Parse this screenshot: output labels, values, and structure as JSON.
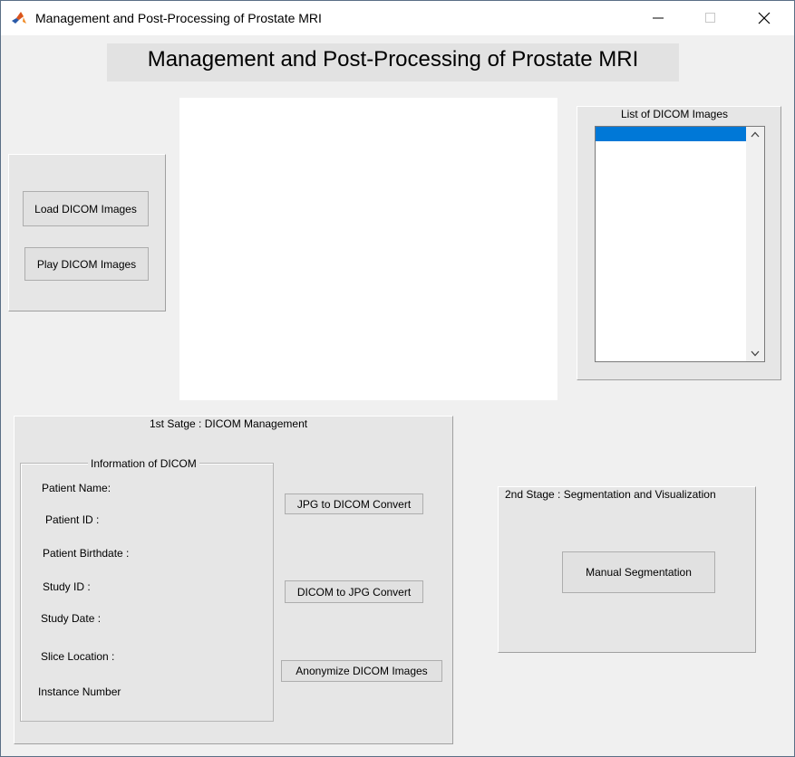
{
  "window": {
    "title": "Management and Post-Processing  of Prostate MRI",
    "icon": "matlab-icon"
  },
  "header": {
    "title": "Management and Post-Processing  of Prostate MRI"
  },
  "load_panel": {
    "load_button": "Load DICOM Images",
    "play_button": "Play DICOM Images"
  },
  "dicom_list": {
    "title": "List of DICOM Images",
    "items": [
      ""
    ]
  },
  "stage1": {
    "title": "1st Satge : DICOM Management",
    "info": {
      "title": "Information of DICOM",
      "labels": {
        "patient_name": "Patient Name:",
        "patient_id": "Patient ID :",
        "patient_birthdate": "Patient Birthdate :",
        "study_id": "Study ID :",
        "study_date": "Study Date :",
        "slice_location": "Slice Location :",
        "instance_number": "Instance Number"
      }
    },
    "jpg_to_dicom": "JPG to DICOM Convert",
    "dicom_to_jpg": "DICOM to JPG Convert",
    "anonymize": "Anonymize DICOM Images"
  },
  "stage2": {
    "title": "2nd Stage : Segmentation and Visualization",
    "manual_segmentation": "Manual Segmentation"
  },
  "colors": {
    "window_bg": "#f0f0f0",
    "panel_bg": "#e6e6e6",
    "list_selection": "#0078d7"
  }
}
